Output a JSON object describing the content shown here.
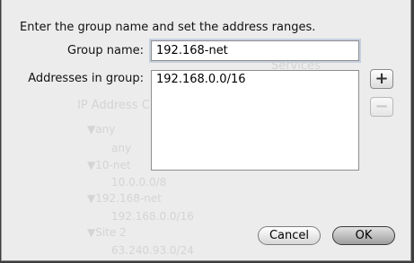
{
  "dialog": {
    "prompt": "Enter the group name and set the address ranges.",
    "group_name_label": "Group name:",
    "group_name_value": "192.168-net",
    "addresses_label": "Addresses in group:",
    "addresses": [
      "192.168.0.0/16"
    ],
    "add_glyph": "+",
    "remove_glyph": "−",
    "cancel_label": "Cancel",
    "ok_label": "OK"
  },
  "background_window": {
    "tab_services": "Services",
    "header_partial": "IP Address C",
    "tree": [
      {
        "group": "any",
        "address": "any"
      },
      {
        "group": "10-net",
        "address": "10.0.0.0/8"
      },
      {
        "group": "192.168-net",
        "address": "192.168.0.0/16"
      },
      {
        "group": "Site 2",
        "address": "63.240.93.0/24"
      }
    ]
  },
  "icons": {
    "add": "plus-icon",
    "remove": "minus-icon",
    "disclosure": "triangle-down-icon"
  }
}
